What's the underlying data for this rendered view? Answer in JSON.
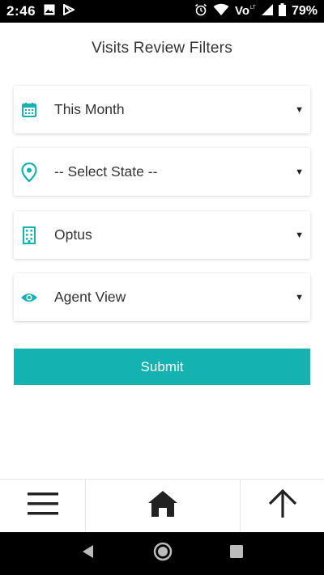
{
  "status_bar": {
    "time": "2:46",
    "battery_percent": "79%",
    "icons_left": [
      "gallery-icon",
      "play-store-icon"
    ],
    "icons_right": [
      "alarm-icon",
      "wifi-icon",
      "volte-icon",
      "signal-icon",
      "battery-icon"
    ]
  },
  "page": {
    "title": "Visits Review Filters"
  },
  "filters": [
    {
      "icon": "calendar-icon",
      "value": "This Month"
    },
    {
      "icon": "location-pin-icon",
      "value": "-- Select State --"
    },
    {
      "icon": "building-icon",
      "value": "Optus"
    },
    {
      "icon": "eye-icon",
      "value": "Agent View"
    }
  ],
  "submit": {
    "label": "Submit"
  },
  "bottom_nav": {
    "items": [
      "menu-icon",
      "home-icon",
      "arrow-up-icon"
    ]
  },
  "android_nav": {
    "items": [
      "back-icon",
      "home-circle-icon",
      "recents-icon"
    ]
  },
  "colors": {
    "accent": "#14b2b0",
    "text": "#333333",
    "status_bar": "#000000"
  }
}
